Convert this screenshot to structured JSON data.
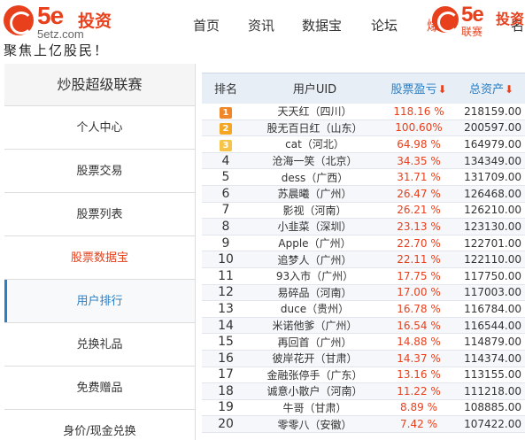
{
  "header": {
    "logo_5e": "5e",
    "logo_cn": "投资",
    "logo_url": "5etz.com",
    "slogan": "聚焦上亿股民！",
    "nav": [
      "首页",
      "资讯",
      "数据宝",
      "论坛",
      "爆",
      "名"
    ],
    "logo2_url": "联赛"
  },
  "sidebar": {
    "title": "炒股超级联赛",
    "items": [
      {
        "label": "个人中心"
      },
      {
        "label": "股票交易"
      },
      {
        "label": "股票列表"
      },
      {
        "label": "股票数据宝"
      },
      {
        "label": "用户排行"
      },
      {
        "label": "兑换礼品"
      },
      {
        "label": "免费赠品"
      },
      {
        "label": "身价/现金兑换"
      }
    ]
  },
  "table": {
    "headers": [
      "排名",
      "用户UID",
      "股票盈亏",
      "总资产"
    ],
    "sort_arrow": "⬇",
    "rows": [
      {
        "rank": "1",
        "user": "天天红（四川）",
        "pct": "118.16 %",
        "assets": "218159.00"
      },
      {
        "rank": "2",
        "user": "股无百日红（山东）",
        "pct": "100.60%",
        "assets": "200597.00"
      },
      {
        "rank": "3",
        "user": "cat（河北）",
        "pct": "64.98 %",
        "assets": "164979.00"
      },
      {
        "rank": "4",
        "user": "沧海一笑（北京）",
        "pct": "34.35 %",
        "assets": "134349.00"
      },
      {
        "rank": "5",
        "user": "dess（广西）",
        "pct": "31.71 %",
        "assets": "131709.00"
      },
      {
        "rank": "6",
        "user": "苏晨曦（广州）",
        "pct": "26.47 %",
        "assets": "126468.00"
      },
      {
        "rank": "7",
        "user": "影视（河南）",
        "pct": "26.21 %",
        "assets": "126210.00"
      },
      {
        "rank": "8",
        "user": "小韭菜（深圳）",
        "pct": "23.13 %",
        "assets": "123130.00"
      },
      {
        "rank": "9",
        "user": "Apple（广州）",
        "pct": "22.70 %",
        "assets": "122701.00"
      },
      {
        "rank": "10",
        "user": "追梦人（广州）",
        "pct": "22.11 %",
        "assets": "122110.00"
      },
      {
        "rank": "11",
        "user": "93入市（广州）",
        "pct": "17.75 %",
        "assets": "117750.00"
      },
      {
        "rank": "12",
        "user": "易碎品（河南）",
        "pct": "17.00 %",
        "assets": "117003.00"
      },
      {
        "rank": "13",
        "user": "duce（贵州）",
        "pct": "16.78 %",
        "assets": "116784.00"
      },
      {
        "rank": "14",
        "user": "米诺他爹（广州）",
        "pct": "16.54 %",
        "assets": "116544.00"
      },
      {
        "rank": "15",
        "user": "再回首（广州）",
        "pct": "14.88 %",
        "assets": "114879.00"
      },
      {
        "rank": "16",
        "user": "彼岸花开（甘肃）",
        "pct": "14.37 %",
        "assets": "114374.00"
      },
      {
        "rank": "17",
        "user": "金融张停手（广东）",
        "pct": "13.16 %",
        "assets": "113155.00"
      },
      {
        "rank": "18",
        "user": "诚意小散户（河南）",
        "pct": "11.22 %",
        "assets": "111218.00"
      },
      {
        "rank": "19",
        "user": "牛哥（甘肃）",
        "pct": "8.89 %",
        "assets": "108885.00"
      },
      {
        "rank": "20",
        "user": "零零八（安徽）",
        "pct": "7.42 %",
        "assets": "107422.00"
      }
    ]
  },
  "colors": {
    "brand": "#e8401c",
    "link": "#2a7ec4",
    "header_bg": "#e8eef6"
  }
}
